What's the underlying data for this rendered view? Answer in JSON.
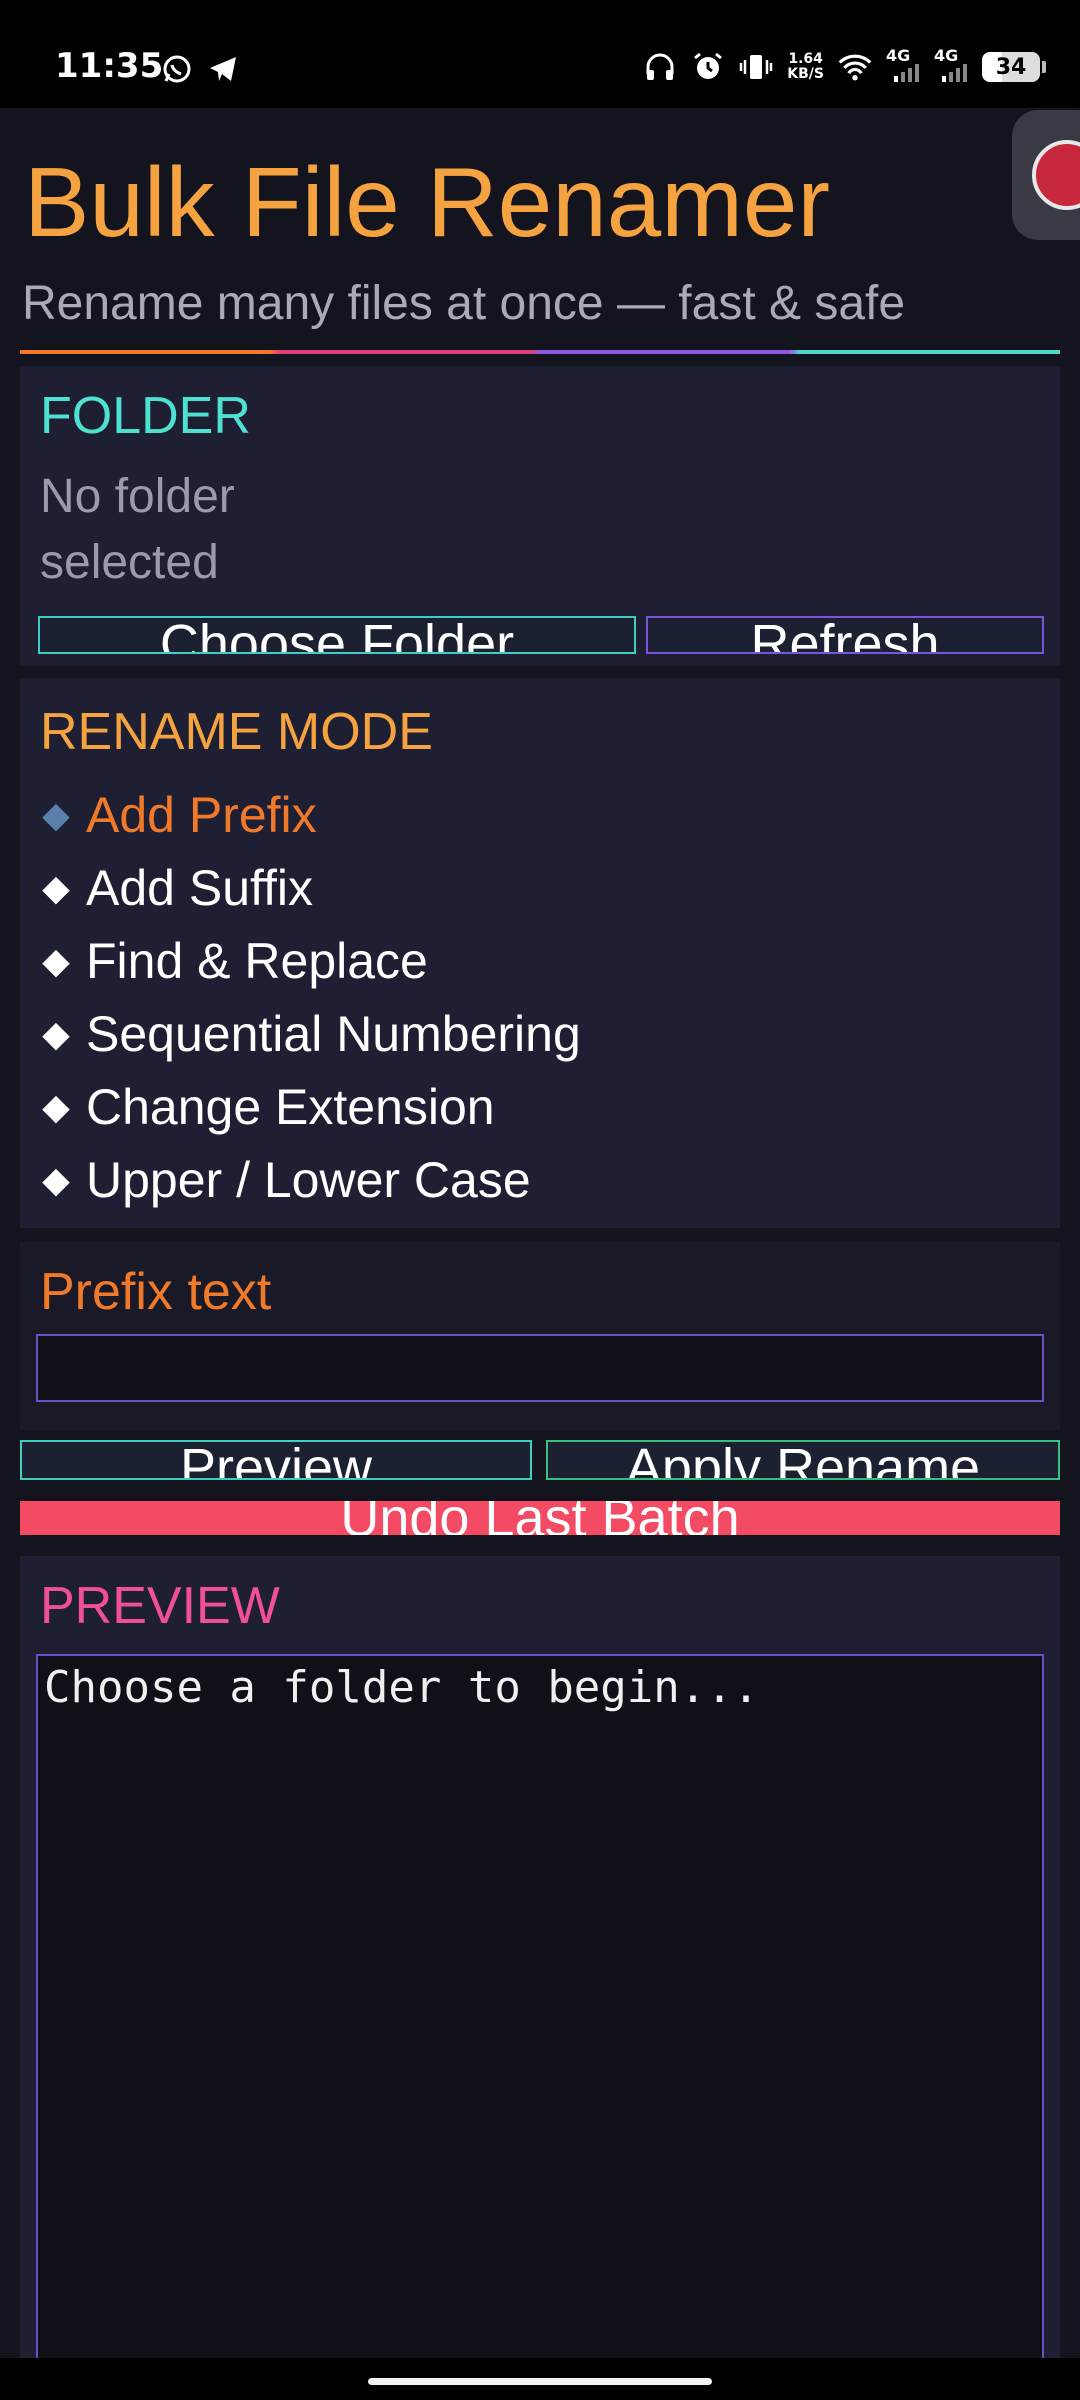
{
  "status_bar": {
    "time": "11:35",
    "left_icons": [
      "whatsapp-icon",
      "telegram-icon"
    ],
    "speed_value": "1.64",
    "speed_unit": "KB/S",
    "network_1": "4G",
    "network_2": "4G",
    "battery": "34"
  },
  "header": {
    "title": "Bulk File Renamer",
    "subtitle": "Rename many files at once — fast & safe"
  },
  "folder": {
    "label": "FOLDER",
    "status": "No folder selected",
    "choose_button": "Choose Folder",
    "refresh_button": "Refresh"
  },
  "rename_mode": {
    "label": "RENAME MODE",
    "selected": "Add Prefix",
    "options": [
      {
        "label": "Add Prefix",
        "active": true
      },
      {
        "label": "Add Suffix",
        "active": false
      },
      {
        "label": "Find & Replace",
        "active": false
      },
      {
        "label": "Sequential Numbering",
        "active": false
      },
      {
        "label": "Change Extension",
        "active": false
      },
      {
        "label": "Upper / Lower Case",
        "active": false
      }
    ]
  },
  "prefix": {
    "label": "Prefix text",
    "value": ""
  },
  "actions": {
    "preview_button": "Preview",
    "apply_button": "Apply Rename",
    "undo_button": "Undo Last Batch"
  },
  "preview": {
    "label": "PREVIEW",
    "content": "Choose a folder to begin..."
  },
  "colors": {
    "accent_orange": "#f4a340",
    "accent_teal": "#4ee0d0",
    "accent_pink": "#f0509a",
    "accent_purple": "#7a55e0",
    "undo_red": "#f24b63",
    "background": "#14141f"
  }
}
